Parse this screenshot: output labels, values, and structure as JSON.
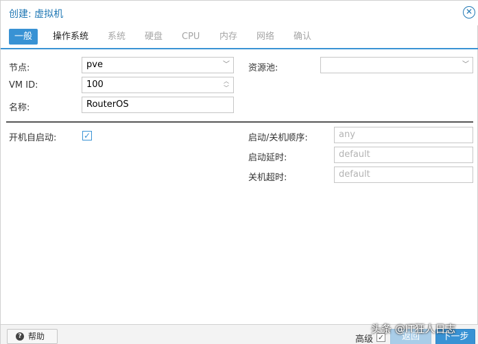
{
  "dialog": {
    "title": "创建: 虚拟机",
    "close_icon": "close-circle-icon"
  },
  "tabs": [
    {
      "label": "一般",
      "state": "active"
    },
    {
      "label": "操作系统",
      "state": "enabled"
    },
    {
      "label": "系统",
      "state": "disabled"
    },
    {
      "label": "硬盘",
      "state": "disabled"
    },
    {
      "label": "CPU",
      "state": "disabled"
    },
    {
      "label": "内存",
      "state": "disabled"
    },
    {
      "label": "网络",
      "state": "disabled"
    },
    {
      "label": "确认",
      "state": "disabled"
    }
  ],
  "form": {
    "node": {
      "label": "节点:",
      "value": "pve"
    },
    "pool": {
      "label": "资源池:",
      "value": ""
    },
    "vmid": {
      "label": "VM ID:",
      "value": "100"
    },
    "name": {
      "label": "名称:",
      "value": "RouterOS"
    },
    "onboot": {
      "label": "开机自启动:",
      "checked": true
    },
    "startup_order": {
      "label": "启动/关机顺序:",
      "placeholder": "any"
    },
    "startup_delay": {
      "label": "启动延时:",
      "placeholder": "default"
    },
    "shutdown_timeout": {
      "label": "关机超时:",
      "placeholder": "default"
    }
  },
  "footer": {
    "help_label": "帮助",
    "advanced_label": "高级",
    "advanced_checked": true,
    "back_label": "返回",
    "next_label": "下一步"
  },
  "watermark": "头条 @IT狂人日志",
  "colors": {
    "accent": "#3892d4",
    "title": "#1f77b4",
    "disabled_tab": "#a5a5a5"
  }
}
